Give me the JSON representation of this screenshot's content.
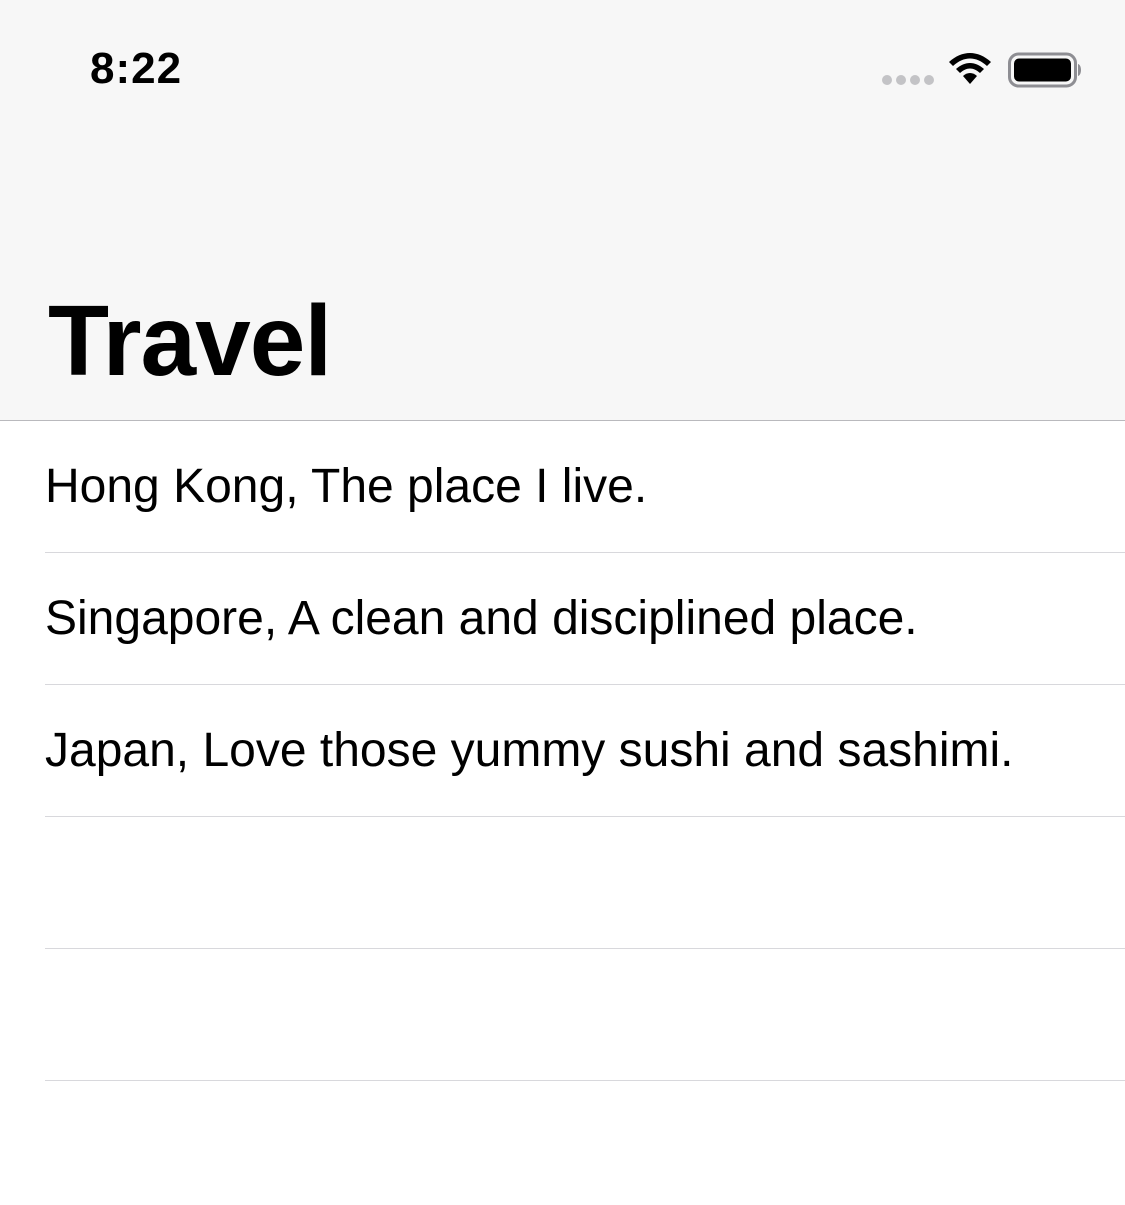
{
  "status_bar": {
    "time": "8:22",
    "icons": [
      "signal-dots-icon",
      "wifi-icon",
      "battery-icon"
    ]
  },
  "navigation": {
    "large_title": "Travel"
  },
  "list": {
    "rows": [
      {
        "label": "Hong Kong, The place I live."
      },
      {
        "label": "Singapore, A clean and disciplined place."
      },
      {
        "label": "Japan, Love those yummy sushi and sashimi."
      },
      {
        "label": ""
      },
      {
        "label": ""
      }
    ]
  },
  "colors": {
    "nav_background": "#f7f7f7",
    "separator": "#d8d8dc",
    "text": "#000000"
  }
}
